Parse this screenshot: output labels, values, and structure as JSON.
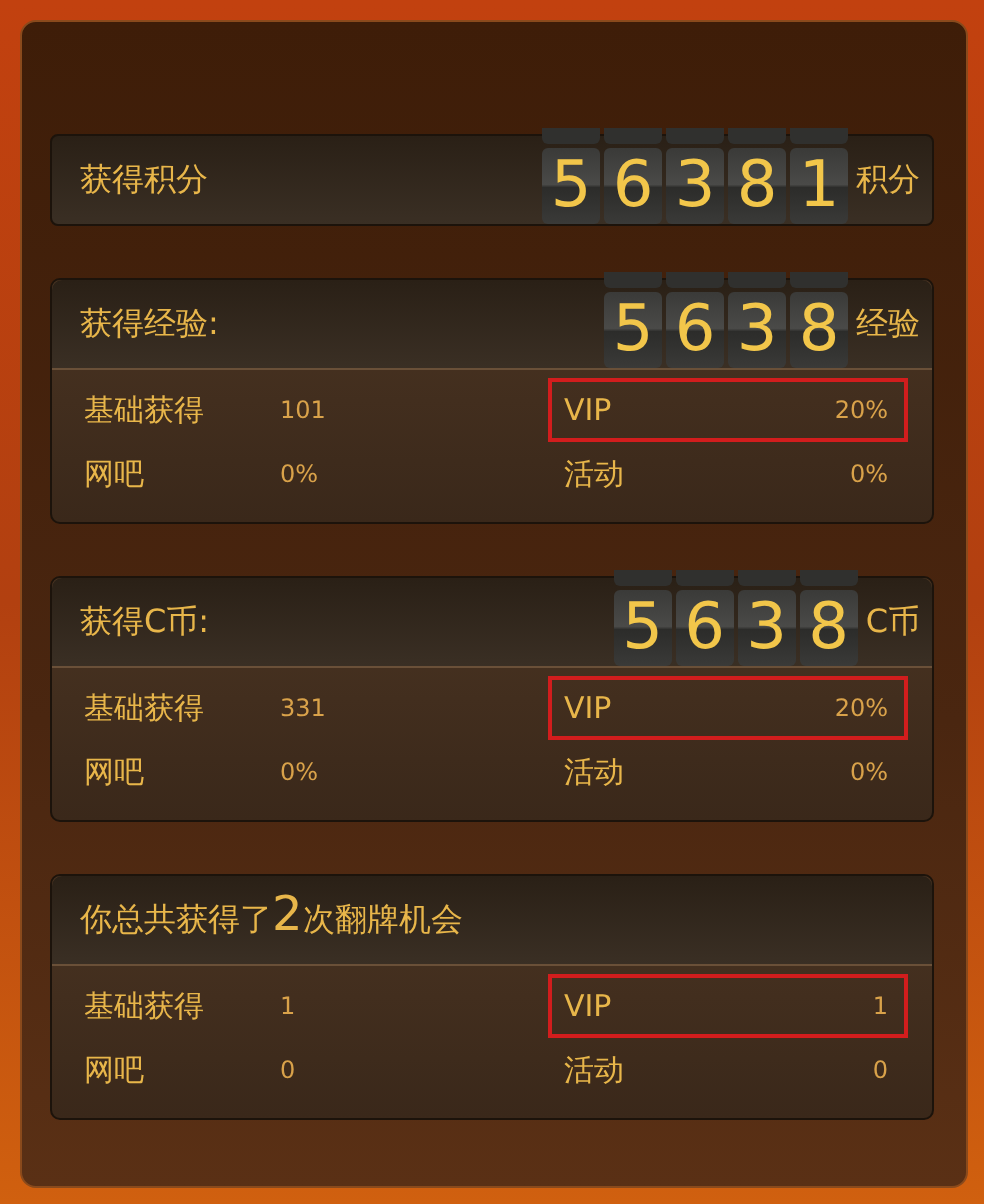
{
  "score": {
    "title": "获得积分",
    "digits": [
      "5",
      "6",
      "3",
      "8",
      "1"
    ],
    "unit": "积分"
  },
  "sections": [
    {
      "title": "获得经验:",
      "digits": [
        "5",
        "6",
        "3",
        "8"
      ],
      "unit": "经验",
      "stats": [
        {
          "label": "基础获得",
          "value": "101",
          "highlighted": false
        },
        {
          "label": "VIP",
          "value": "20%",
          "highlighted": true
        },
        {
          "label": "网吧",
          "value": "0%",
          "highlighted": false
        },
        {
          "label": "活动",
          "value": "0%",
          "highlighted": false
        }
      ]
    },
    {
      "title": "获得C币:",
      "digits": [
        "5",
        "6",
        "3",
        "8"
      ],
      "unit": "C币",
      "stats": [
        {
          "label": "基础获得",
          "value": "331",
          "highlighted": false
        },
        {
          "label": "VIP",
          "value": "20%",
          "highlighted": true
        },
        {
          "label": "网吧",
          "value": "0%",
          "highlighted": false
        },
        {
          "label": "活动",
          "value": "0%",
          "highlighted": false
        }
      ]
    },
    {
      "title": "你总共获得了**2**次翻牌机会",
      "stats": [
        {
          "label": "基础获得",
          "value": "1",
          "highlighted": false
        },
        {
          "label": "VIP",
          "value": "1",
          "highlighted": true
        },
        {
          "label": "网吧",
          "value": "0",
          "highlighted": false
        },
        {
          "label": "活动",
          "value": "0",
          "highlighted": false
        }
      ]
    }
  ]
}
